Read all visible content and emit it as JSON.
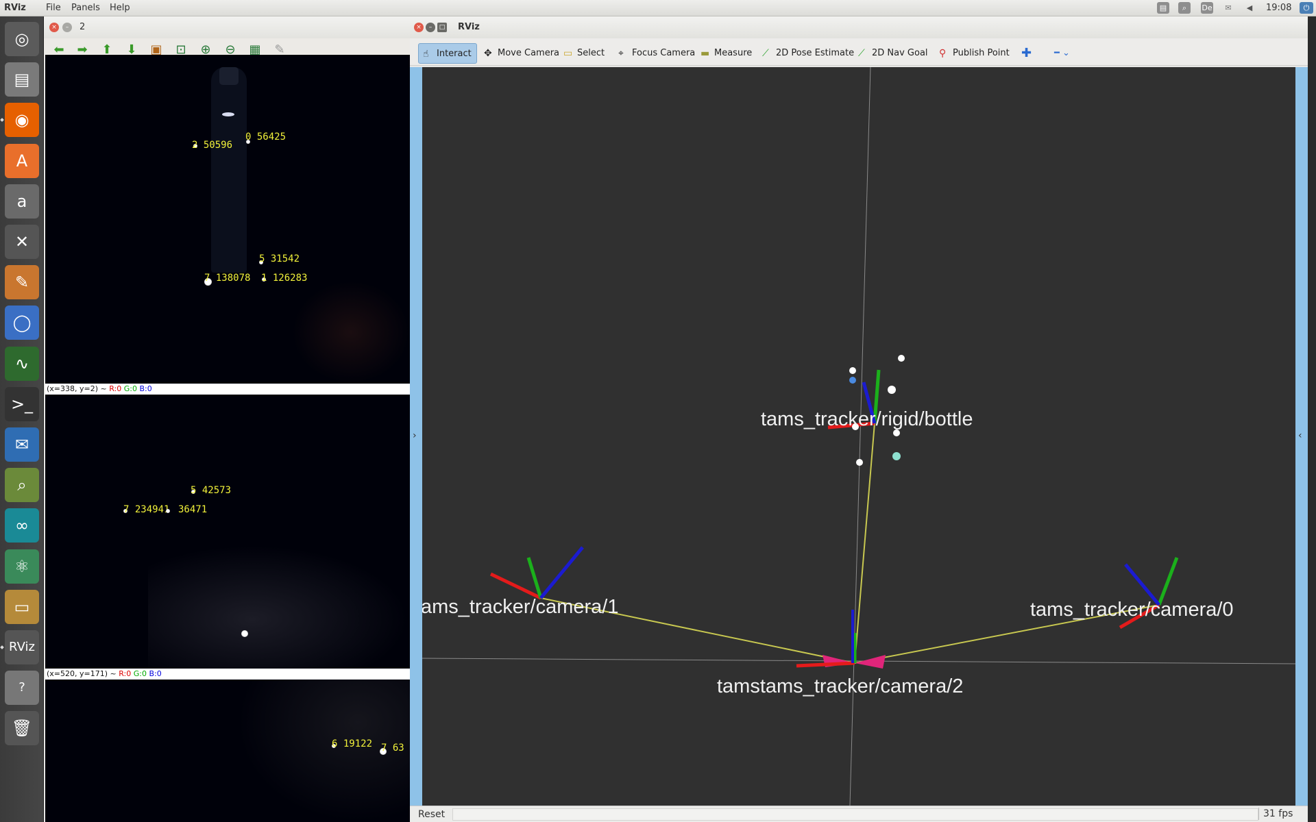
{
  "topbar": {
    "app": "RViz",
    "menus": [
      "File",
      "Panels",
      "Help"
    ],
    "tray": [
      "clipboard-icon",
      "search-icon",
      "De",
      "mail-icon",
      "volume-icon"
    ],
    "time": "19:08"
  },
  "launcher": {
    "items": [
      {
        "icon": "ubuntu-dash-icon",
        "color": "#5b5b5b"
      },
      {
        "icon": "files-icon",
        "color": "#7a7a7a"
      },
      {
        "icon": "firefox-icon",
        "color": "#e66000"
      },
      {
        "icon": "software-center-icon",
        "color": "#e96f2b"
      },
      {
        "icon": "amazon-icon",
        "color": "#6a6a6a"
      },
      {
        "icon": "system-settings-icon",
        "color": "#555"
      },
      {
        "icon": "text-editor-icon",
        "color": "#c9762f"
      },
      {
        "icon": "chromium-icon",
        "color": "#3a6fc4"
      },
      {
        "icon": "system-monitor-icon",
        "color": "#2e6a2e"
      },
      {
        "icon": "terminal-icon",
        "color": "#333"
      },
      {
        "icon": "mail-client-icon",
        "color": "#2f6db3"
      },
      {
        "icon": "image-viewer-icon",
        "color": "#6b8a3a"
      },
      {
        "icon": "arduino-icon",
        "color": "#1a8a96"
      },
      {
        "icon": "atom-icon",
        "color": "#3a8a5a"
      },
      {
        "icon": "disk-icon",
        "color": "#b58a3a"
      },
      {
        "icon": "rviz-icon",
        "color": "#555",
        "label": "RViz"
      },
      {
        "icon": "help-icon",
        "color": "#777",
        "label": "?"
      },
      {
        "icon": "trash-icon",
        "color": "#555"
      }
    ]
  },
  "image_window": {
    "title": "2",
    "status1": {
      "text": "(x=338, y=2) ~ ",
      "r": "R:0",
      "g": "G:0",
      "b": "B:0"
    },
    "status2": {
      "text": "(x=520, y=171) ~ ",
      "r": "R:0",
      "g": "G:0",
      "b": "B:0"
    },
    "pane1_labels": [
      "2  50596",
      "0  56425",
      "5  31542",
      "7  138078",
      "1  126283"
    ],
    "pane2_labels": [
      "5  42573",
      "7 234941",
      "36471"
    ],
    "pane3_labels": [
      "6  19122",
      "7  63"
    ]
  },
  "rviz": {
    "title": "RViz",
    "tools": [
      "Interact",
      "Move Camera",
      "Select",
      "Focus Camera",
      "Measure",
      "2D Pose Estimate",
      "2D Nav Goal",
      "Publish Point"
    ],
    "frames": {
      "bottle": "tams_tracker/rigid/bottle",
      "camera1": "ams_tracker/camera/1",
      "camera0": "tams_tracker/camera/0",
      "camera2": "tamstams_tracker/camera/2"
    },
    "reset": "Reset",
    "fps": "31 fps"
  }
}
